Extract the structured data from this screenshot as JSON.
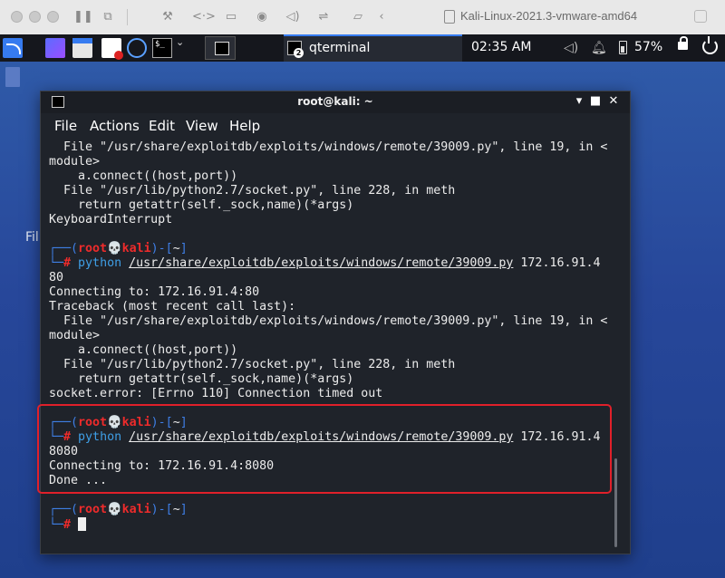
{
  "vmware": {
    "title": "Kali-Linux-2021.3-vmware-amd64"
  },
  "panel": {
    "task_label": "qterminal",
    "task_badge": "2",
    "clock": "02:35 AM",
    "battery_pct": "57%"
  },
  "desktop": {
    "label": "Fil"
  },
  "window": {
    "title": "root@kali: ~",
    "menu": [
      "File",
      "Actions",
      "Edit",
      "View",
      "Help"
    ],
    "minimize": "▾",
    "maximize": "■",
    "close": "✕"
  },
  "terminal": {
    "lines": [
      "  File \"/usr/share/exploitdb/exploits/windows/remote/39009.py\", line 19, in <",
      "module>",
      "    a.connect((host,port))",
      "  File \"/usr/lib/python2.7/socket.py\", line 228, in meth",
      "    return getattr(self._sock,name)(*args)",
      "KeyboardInterrupt",
      "80",
      "Connecting to: 172.16.91.4:80",
      "Traceback (most recent call last):",
      "  File \"/usr/share/exploitdb/exploits/windows/remote/39009.py\", line 19, in <",
      "module>",
      "    a.connect((host,port))",
      "  File \"/usr/lib/python2.7/socket.py\", line 228, in meth",
      "    return getattr(self._sock,name)(*args)",
      "socket.error: [Errno 110] Connection timed out",
      "8080",
      "Connecting to: 172.16.91.4:8080",
      "Done ..."
    ],
    "prompt": {
      "open": "┌──(",
      "user": "root",
      "skull": "💀",
      "host": "kali",
      "close": ")-[",
      "dir": "~",
      "end": "]",
      "corner": "└─",
      "hash": "#"
    },
    "cmd_python": "python",
    "cmd_path": "/usr/share/exploitdb/exploits/windows/remote/39009.py",
    "cmd_arg": "172.16.91.4"
  }
}
